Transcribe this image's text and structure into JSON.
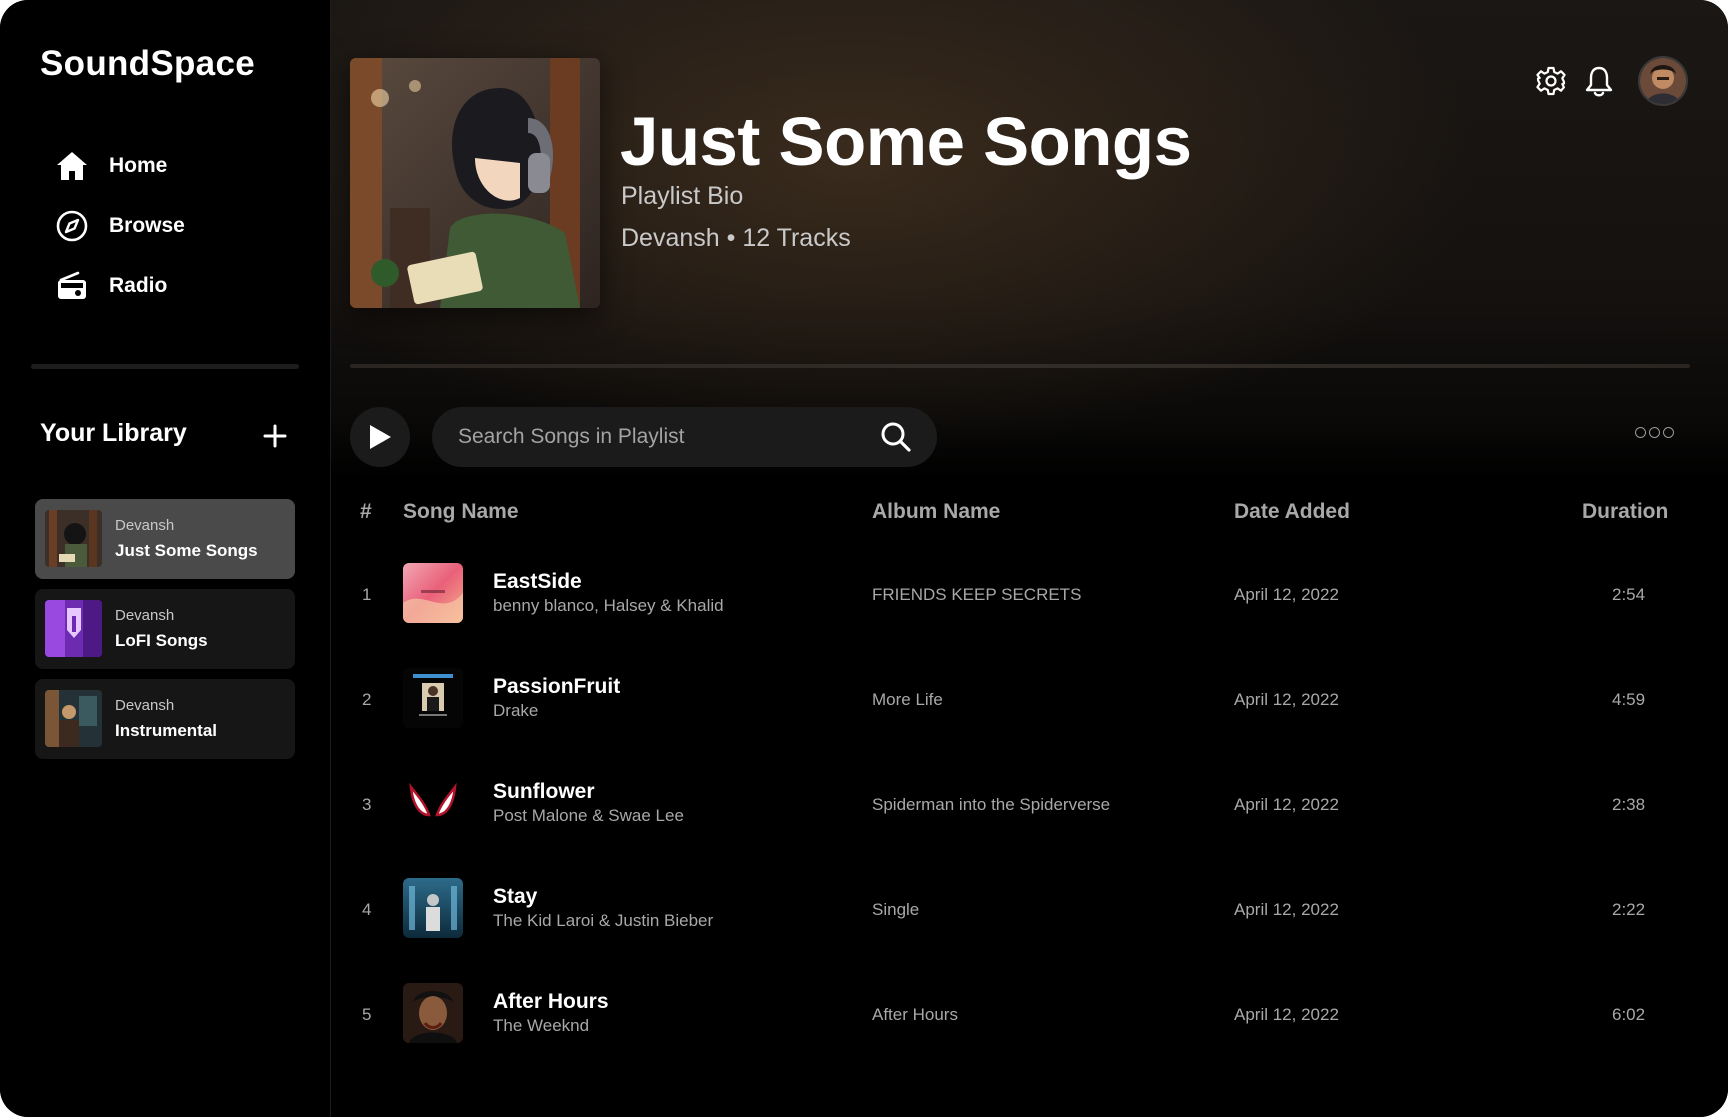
{
  "app": {
    "name": "SoundSpace"
  },
  "nav": [
    {
      "label": "Home",
      "icon": "home-icon"
    },
    {
      "label": "Browse",
      "icon": "compass-icon"
    },
    {
      "label": "Radio",
      "icon": "radio-icon"
    }
  ],
  "library": {
    "title": "Your Library",
    "add_icon": "plus-icon",
    "items": [
      {
        "owner": "Devansh",
        "name": "Just Some Songs",
        "active": true
      },
      {
        "owner": "Devansh",
        "name": "LoFI Songs",
        "active": false
      },
      {
        "owner": "Devansh",
        "name": "Instrumental",
        "active": false
      }
    ]
  },
  "playlist": {
    "title": "Just Some Songs",
    "bio": "Playlist Bio",
    "meta": "Devansh • 12 Tracks"
  },
  "header_icons": [
    "gear-icon",
    "bell-icon",
    "avatar"
  ],
  "search": {
    "placeholder": "Search Songs in Playlist",
    "value": ""
  },
  "table": {
    "headers": {
      "num": "#",
      "song": "Song Name",
      "album": "Album Name",
      "date": "Date Added",
      "duration": "Duration"
    },
    "rows": [
      {
        "num": "1",
        "title": "EastSide",
        "artist": "benny blanco, Halsey & Khalid",
        "album": "FRIENDS KEEP SECRETS",
        "date": "April 12, 2022",
        "duration": "2:54"
      },
      {
        "num": "2",
        "title": "PassionFruit",
        "artist": "Drake",
        "album": "More Life",
        "date": "April 12, 2022",
        "duration": "4:59"
      },
      {
        "num": "3",
        "title": "Sunflower",
        "artist": "Post Malone & Swae Lee",
        "album": "Spiderman into the Spiderverse",
        "date": "April 12, 2022",
        "duration": "2:38"
      },
      {
        "num": "4",
        "title": "Stay",
        "artist": "The Kid Laroi & Justin Bieber",
        "album": "Single",
        "date": "April 12, 2022",
        "duration": "2:22"
      },
      {
        "num": "5",
        "title": "After Hours",
        "artist": "The Weeknd",
        "album": "After Hours",
        "date": "April 12, 2022",
        "duration": "6:02"
      }
    ]
  },
  "colors": {
    "background": "#000000",
    "surface": "#1b1b1b",
    "active_item": "#4a4a4a",
    "muted_text": "#a8a8a8",
    "header_tint": "#563e26"
  }
}
